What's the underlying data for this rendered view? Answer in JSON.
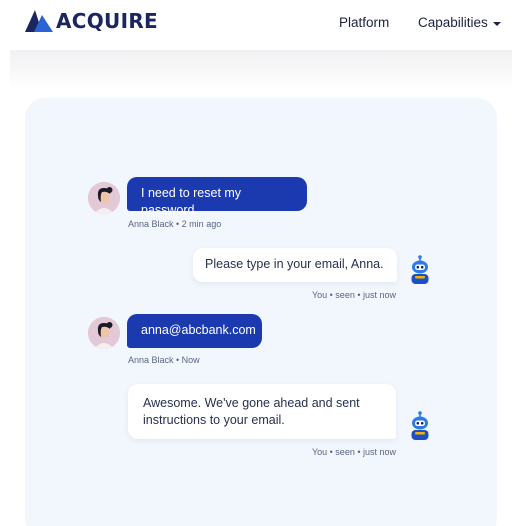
{
  "header": {
    "logo_text": "ACQUIRE",
    "nav": [
      {
        "label": "Platform"
      },
      {
        "label": "Capabilities"
      }
    ]
  },
  "colors": {
    "brand_navy": "#1b2660",
    "user_bubble": "#1b3ab0",
    "panel_bg": "#f1f7fc",
    "bot_accent": "#2e7be6"
  },
  "chat": {
    "messages": [
      {
        "sender": "user",
        "text": "I need to reset my password",
        "meta": "Anna Black • 2 min ago"
      },
      {
        "sender": "bot",
        "text": "Please type in your email, Anna.",
        "meta": "You • seen • just now"
      },
      {
        "sender": "user",
        "text": "anna@abcbank.com",
        "meta": "Anna Black • Now"
      },
      {
        "sender": "bot",
        "text": "Awesome. We've gone ahead and sent instructions to your email.",
        "meta": "You • seen • just now"
      }
    ]
  },
  "icons": {
    "logo": "acquire-logo-icon",
    "user_avatar": "user-avatar-icon",
    "bot_avatar": "robot-icon",
    "dropdown": "chevron-down-icon"
  }
}
